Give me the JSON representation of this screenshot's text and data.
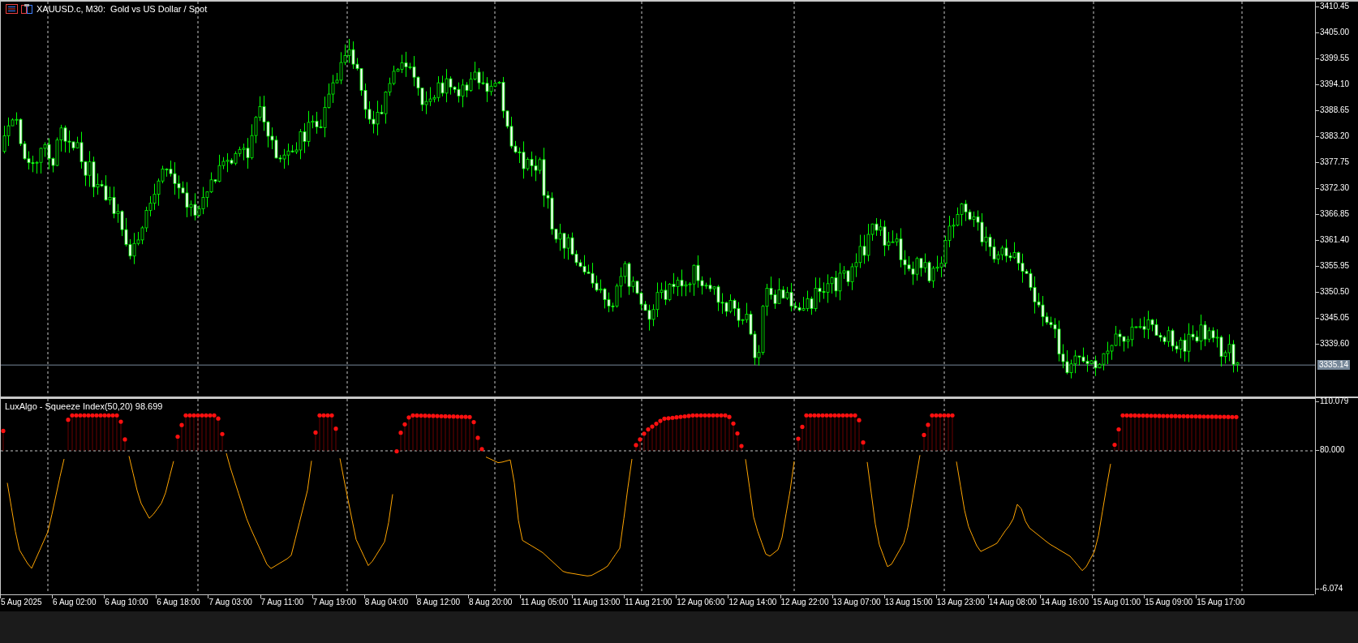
{
  "window": {
    "symbol_title": "XAUUSD.c, M30:  Gold vs US Dollar / Spot"
  },
  "price_axis": {
    "labels": [
      "3410.45",
      "3405.00",
      "3399.55",
      "3394.10",
      "3388.65",
      "3383.20",
      "3377.75",
      "3372.30",
      "3366.85",
      "3361.40",
      "3355.95",
      "3350.50",
      "3345.05",
      "3339.60"
    ],
    "current_price": "3335.14"
  },
  "indicator": {
    "title": "LuxAlgo - Squeeze Index(50,20) 98.699",
    "axis_labels": [
      "110.079",
      "80.000",
      "-6.074"
    ]
  },
  "time_axis": {
    "labels": [
      "5 Aug 2025",
      "6 Aug 02:00",
      "6 Aug 10:00",
      "6 Aug 18:00",
      "7 Aug 03:00",
      "7 Aug 11:00",
      "7 Aug 19:00",
      "8 Aug 04:00",
      "8 Aug 12:00",
      "8 Aug 20:00",
      "11 Aug 05:00",
      "11 Aug 13:00",
      "11 Aug 21:00",
      "12 Aug 06:00",
      "12 Aug 14:00",
      "12 Aug 22:00",
      "13 Aug 07:00",
      "13 Aug 15:00",
      "13 Aug 23:00",
      "14 Aug 08:00",
      "14 Aug 16:00",
      "15 Aug 01:00",
      "15 Aug 09:00",
      "15 Aug 17:00"
    ]
  }
}
